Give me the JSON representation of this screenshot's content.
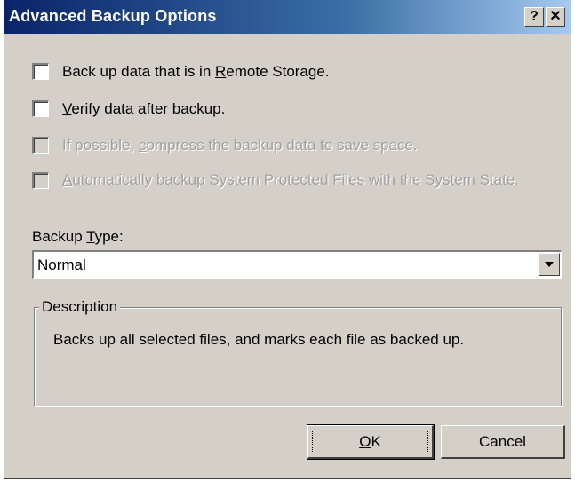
{
  "window": {
    "title": "Advanced Backup Options",
    "help_button": "?",
    "close_button": "✕"
  },
  "options": [
    {
      "pre": "Back up data that is in ",
      "key": "R",
      "post": "emote Storage.",
      "checked": false,
      "enabled": true
    },
    {
      "pre": "",
      "key": "V",
      "post": "erify data after backup.",
      "checked": false,
      "enabled": true
    },
    {
      "pre": "If possible, ",
      "key": "c",
      "post": "ompress the backup data to save space.",
      "checked": false,
      "enabled": false
    },
    {
      "pre": "",
      "key": "A",
      "post": "utomatically backup System Protected Files with the System State.",
      "checked": false,
      "enabled": false
    }
  ],
  "backup_type": {
    "label_pre": "Backup ",
    "label_key": "T",
    "label_post": "ype:",
    "selected": "Normal"
  },
  "description": {
    "group_title": "Description",
    "text": "Backs up all selected files, and marks each file as backed up."
  },
  "buttons": {
    "ok_key": "O",
    "ok_post": "K",
    "cancel": "Cancel"
  }
}
